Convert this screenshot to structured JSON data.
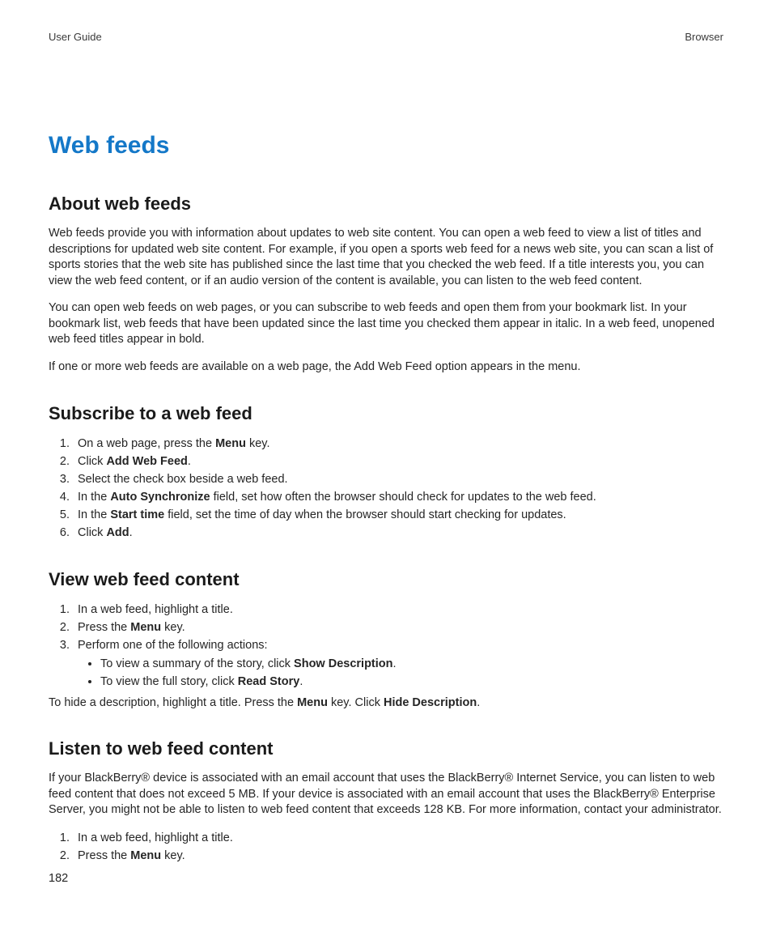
{
  "header": {
    "left": "User Guide",
    "right": "Browser"
  },
  "title": "Web feeds",
  "sections": {
    "about": {
      "heading": "About web feeds",
      "p1": "Web feeds provide you with information about updates to web site content. You can open a web feed to view a list of titles and descriptions for updated web site content. For example, if you open a sports web feed for a news web site, you can scan a list of sports stories that the web site has published since the last time that you checked the web feed. If a title interests you, you can view the web feed content, or if an audio version of the content is available, you can listen to the web feed content.",
      "p2": "You can open web feeds on web pages, or you can subscribe to web feeds and open them from your bookmark list. In your bookmark list, web feeds that have been updated since the last time you checked them appear in italic. In a web feed, unopened web feed titles appear in bold.",
      "p3": "If one or more web feeds are available on a web page, the Add Web Feed option appears in the menu."
    },
    "subscribe": {
      "heading": "Subscribe to a web feed",
      "s1a": "On a web page, press the ",
      "s1b": "Menu",
      "s1c": " key.",
      "s2a": "Click ",
      "s2b": "Add Web Feed",
      "s2c": ".",
      "s3": "Select the check box beside a web feed.",
      "s4a": "In the ",
      "s4b": "Auto Synchronize",
      "s4c": " field, set how often the browser should check for updates to the web feed.",
      "s5a": "In the ",
      "s5b": "Start time",
      "s5c": " field, set the time of day when the browser should start checking for updates.",
      "s6a": "Click ",
      "s6b": "Add",
      "s6c": "."
    },
    "view": {
      "heading": "View web feed content",
      "s1": "In a web feed, highlight a title.",
      "s2a": "Press the ",
      "s2b": "Menu",
      "s2c": " key.",
      "s3": "Perform one of the following actions:",
      "b1a": "To view a summary of the story, click ",
      "b1b": "Show Description",
      "b1c": ".",
      "b2a": "To view the full story, click ",
      "b2b": "Read Story",
      "b2c": ".",
      "note_a": "To hide a description, highlight a title. Press the ",
      "note_b": "Menu",
      "note_c": " key. Click ",
      "note_d": "Hide Description",
      "note_e": "."
    },
    "listen": {
      "heading": "Listen to web feed content",
      "p1": "If your BlackBerry® device is associated with an email account that uses the BlackBerry® Internet Service, you can listen to web feed content that does not exceed 5 MB. If your device is associated with an email account that uses the BlackBerry® Enterprise Server, you might not be able to listen to web feed content that exceeds 128 KB. For more information, contact your administrator.",
      "s1": "In a web feed, highlight a title.",
      "s2a": "Press the ",
      "s2b": "Menu",
      "s2c": " key."
    }
  },
  "page_number": "182"
}
